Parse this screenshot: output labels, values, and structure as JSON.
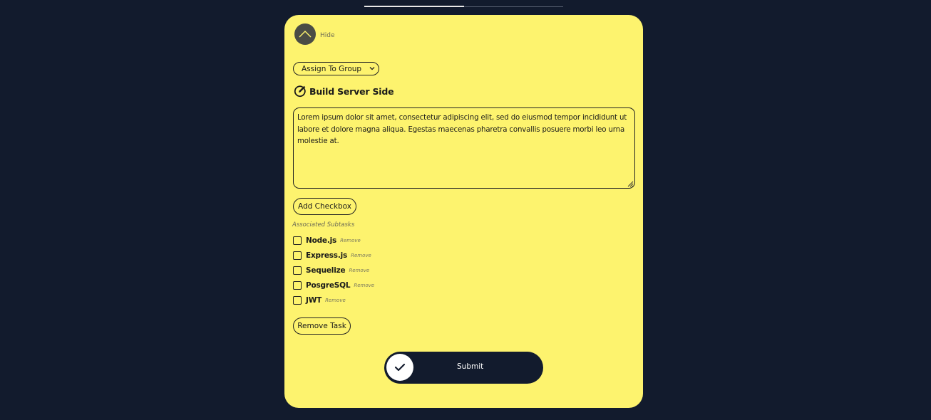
{
  "colors": {
    "background": "#121b2d",
    "card": "#fdf36e",
    "accent_dark": "#121b2d"
  },
  "header": {
    "hide_label": "Hide",
    "hide_icon": "chevron-up-icon"
  },
  "group_select": {
    "selected": "Assign To Group"
  },
  "task": {
    "title": "Build Server Side",
    "title_icon": "edit-icon",
    "description": "Lorem ipsum dolor sit amet, consectetur adipiscing elit, sed do eiusmod tempor incididunt ut labore et dolore magna aliqua. Egestas maecenas pharetra convallis posuere morbi leo urna molestie at."
  },
  "actions": {
    "add_checkbox": "Add Checkbox",
    "remove_task": "Remove Task",
    "submit": "Submit",
    "submit_icon": "checkmark-icon"
  },
  "subtasks": {
    "heading": "Associated Subtasks",
    "items": [
      {
        "name": "Node.js",
        "remove_label": "Remove",
        "checked": false
      },
      {
        "name": "Express.js",
        "remove_label": "Remove",
        "checked": false
      },
      {
        "name": "Sequelize",
        "remove_label": "Remove",
        "checked": false
      },
      {
        "name": "PosgreSQL",
        "remove_label": "Remove",
        "checked": false
      },
      {
        "name": "JWT",
        "remove_label": "Remove",
        "checked": false
      }
    ]
  }
}
